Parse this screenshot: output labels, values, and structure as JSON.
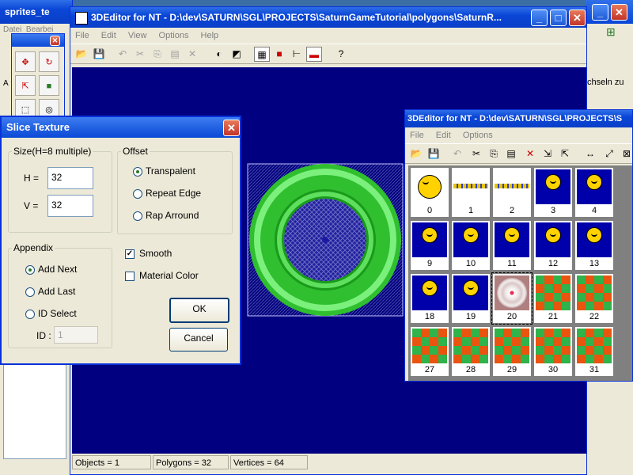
{
  "bg_window": {
    "title": "sprites_te",
    "menu": [
      "Datei",
      "Bearbei"
    ],
    "side_text": "A"
  },
  "right_bg_window": {
    "text": "chseln zu"
  },
  "main_window": {
    "title": "3DEditor for NT - D:\\dev\\SATURN\\SGL\\PROJECTS\\SaturnGameTutorial\\polygons\\SaturnR...",
    "menu": [
      "File",
      "Edit",
      "View",
      "Options",
      "Help"
    ],
    "status": {
      "objects": "Objects = 1",
      "polygons": "Polygons = 32",
      "vertices": "Vertices = 64"
    }
  },
  "dialog": {
    "title": "Slice Texture",
    "size_group": "Size(H=8 multiple)",
    "h_label": "H =",
    "h_value": "32",
    "v_label": "V =",
    "v_value": "32",
    "offset_group": "Offset",
    "offset_options": [
      "Transpalent",
      "Repeat Edge",
      "Rap Arround"
    ],
    "offset_selected": "Transpalent",
    "appendix_group": "Appendix",
    "appendix_options": [
      "Add Next",
      "Add Last",
      "ID Select"
    ],
    "appendix_selected": "Add Next",
    "id_label": "ID :",
    "id_value": "1",
    "smooth_label": "Smooth",
    "smooth_checked": true,
    "material_label": "Material Color",
    "material_checked": false,
    "ok_label": "OK",
    "cancel_label": "Cancel"
  },
  "texture_window": {
    "title": "3DEditor for NT - D:\\dev\\SATURN\\SGL\\PROJECTS\\S",
    "menu": [
      "File",
      "Edit",
      "Options"
    ],
    "tiles": [
      {
        "num": "0",
        "kind": "smiley-sunglasses"
      },
      {
        "num": "1",
        "kind": "bar"
      },
      {
        "num": "2",
        "kind": "bar"
      },
      {
        "num": "3",
        "kind": "smiley"
      },
      {
        "num": "4",
        "kind": "smiley"
      },
      {
        "num": "9",
        "kind": "smiley"
      },
      {
        "num": "10",
        "kind": "smiley"
      },
      {
        "num": "11",
        "kind": "smiley"
      },
      {
        "num": "12",
        "kind": "smiley"
      },
      {
        "num": "13",
        "kind": "smiley"
      },
      {
        "num": "18",
        "kind": "smiley"
      },
      {
        "num": "19",
        "kind": "smiley"
      },
      {
        "num": "20",
        "kind": "disc"
      },
      {
        "num": "21",
        "kind": "checker"
      },
      {
        "num": "22",
        "kind": "checker"
      },
      {
        "num": "27",
        "kind": "checker"
      },
      {
        "num": "28",
        "kind": "checker"
      },
      {
        "num": "29",
        "kind": "checker"
      },
      {
        "num": "30",
        "kind": "checker"
      },
      {
        "num": "31",
        "kind": "checker"
      }
    ]
  },
  "colors": {
    "viewport": "#000080",
    "ring": "#33d633",
    "xp_blue": "#0a46d6"
  }
}
